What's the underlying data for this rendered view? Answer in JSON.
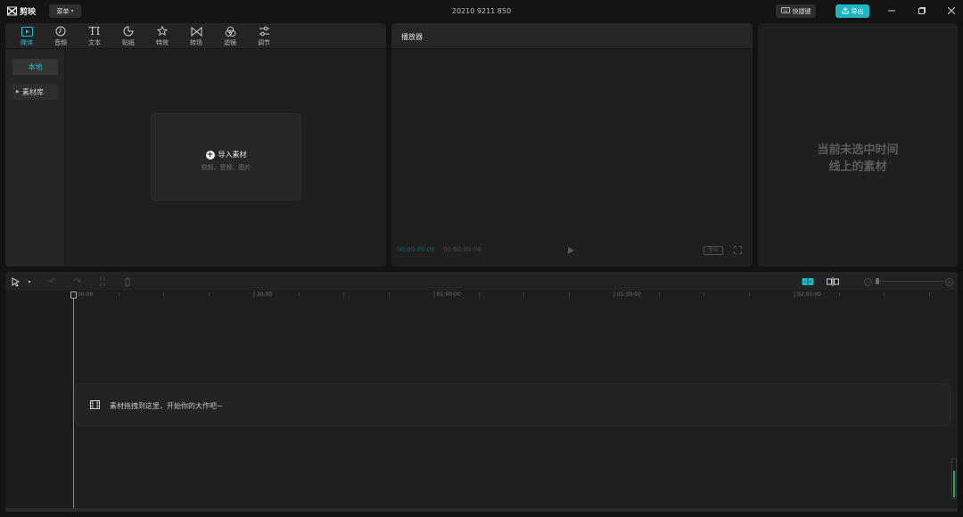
{
  "app": {
    "name": "剪映",
    "menu_label": "菜单",
    "project_title": "20210 9211 850"
  },
  "header": {
    "shortcut_label": "快捷键",
    "export_label": "导出"
  },
  "media_tabs": [
    {
      "label": "媒体",
      "icon": "media-icon",
      "active": true
    },
    {
      "label": "音频",
      "icon": "audio-icon",
      "active": false
    },
    {
      "label": "文本",
      "icon": "text-icon",
      "active": false
    },
    {
      "label": "贴纸",
      "icon": "sticker-icon",
      "active": false
    },
    {
      "label": "特效",
      "icon": "effects-icon",
      "active": false
    },
    {
      "label": "转场",
      "icon": "transition-icon",
      "active": false
    },
    {
      "label": "滤镜",
      "icon": "filter-icon",
      "active": false
    },
    {
      "label": "调节",
      "icon": "adjust-icon",
      "active": false
    }
  ],
  "media_side": {
    "local_label": "本地",
    "library_label": "素材库"
  },
  "import": {
    "label": "导入素材",
    "sub": "视频、音频、图片"
  },
  "player": {
    "title": "播放器",
    "current_time": "00:00:00:00",
    "total_time": "00:00:00:00",
    "ratio_label": "原始"
  },
  "attributes": {
    "empty_line1": "当前未选中时间",
    "empty_line2": "线上的素材"
  },
  "timeline": {
    "ruler_labels": [
      "00:00",
      "| 30:00",
      "| 01:00:00",
      "| 01:30:00",
      "| 02:00:00"
    ],
    "drop_hint": "素材拖拽到这里，开始你的大作吧~"
  },
  "colors": {
    "accent": "#1fb5c2",
    "level": "#2ea84a"
  }
}
